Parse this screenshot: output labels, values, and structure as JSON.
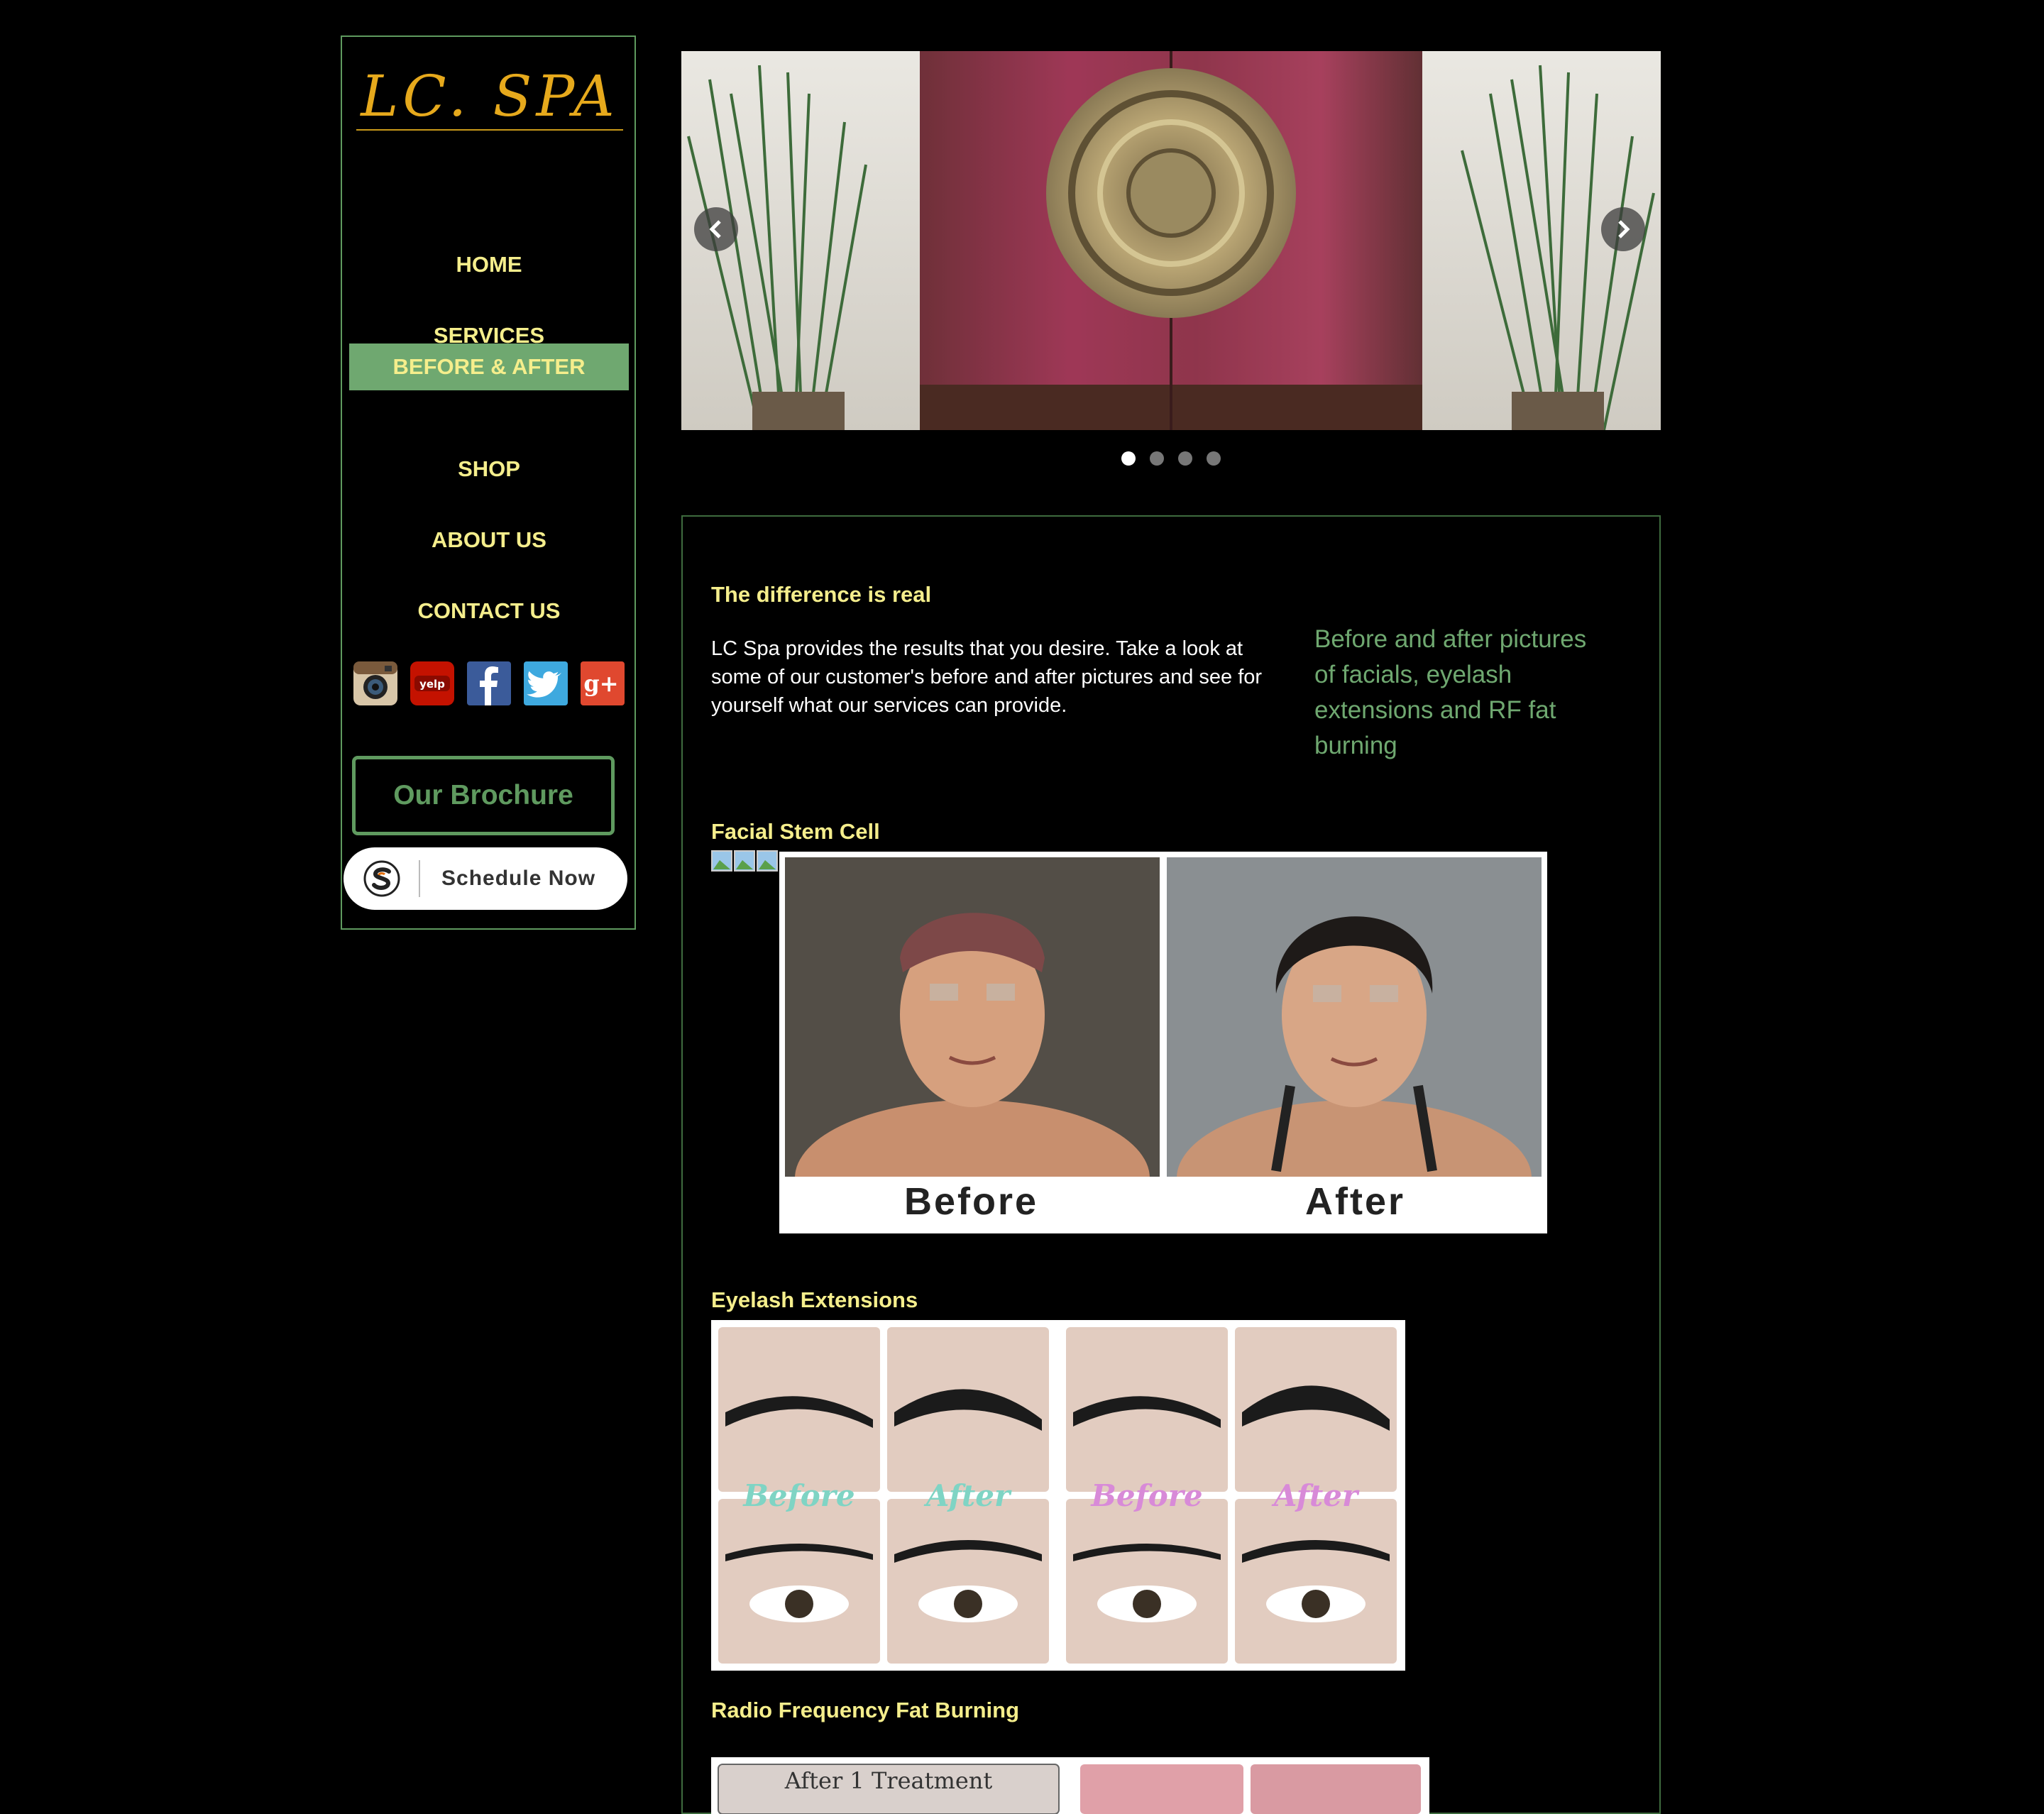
{
  "brand": {
    "logo_text": "LC. SPA"
  },
  "nav": [
    {
      "label": "HOME",
      "active": false
    },
    {
      "label": "SERVICES",
      "active": false
    },
    {
      "label": "BEFORE & AFTER",
      "active": true
    },
    {
      "label": "SHOP",
      "active": false
    },
    {
      "label": "ABOUT US",
      "active": false
    },
    {
      "label": "CONTACT US",
      "active": false
    }
  ],
  "social": [
    {
      "icon": "instagram-icon"
    },
    {
      "icon": "yelp-icon",
      "text": "yelp"
    },
    {
      "icon": "facebook-icon"
    },
    {
      "icon": "twitter-icon"
    },
    {
      "icon": "google-plus-icon",
      "text": "g+"
    }
  ],
  "brochure": {
    "label": "Our Brochure"
  },
  "schedule": {
    "label": "Schedule Now"
  },
  "slider": {
    "total_slides": 4,
    "active_slide": 1
  },
  "content": {
    "intro_heading": "The difference is real",
    "intro_text": "LC Spa provides the results that you desire. Take a look at some of our customer's before and after pictures and see for yourself what our services can provide.",
    "aside_text": "Before and after pictures of facials, eyelash extensions and RF fat burning",
    "sections": [
      {
        "title": "Facial Stem Cell",
        "labels": [
          "Before",
          "After"
        ]
      },
      {
        "title": "Eyelash Extensions",
        "labels": [
          "Before",
          "After",
          "Before",
          "After"
        ]
      },
      {
        "title": "Radio Frequency Fat Burning",
        "labels": [
          "After 1 Treatment"
        ]
      }
    ]
  },
  "colors": {
    "accent_green": "#6fa870",
    "nav_yellow": "#f5ee8c",
    "logo_gold": "#e6a91c",
    "background": "#000000"
  }
}
